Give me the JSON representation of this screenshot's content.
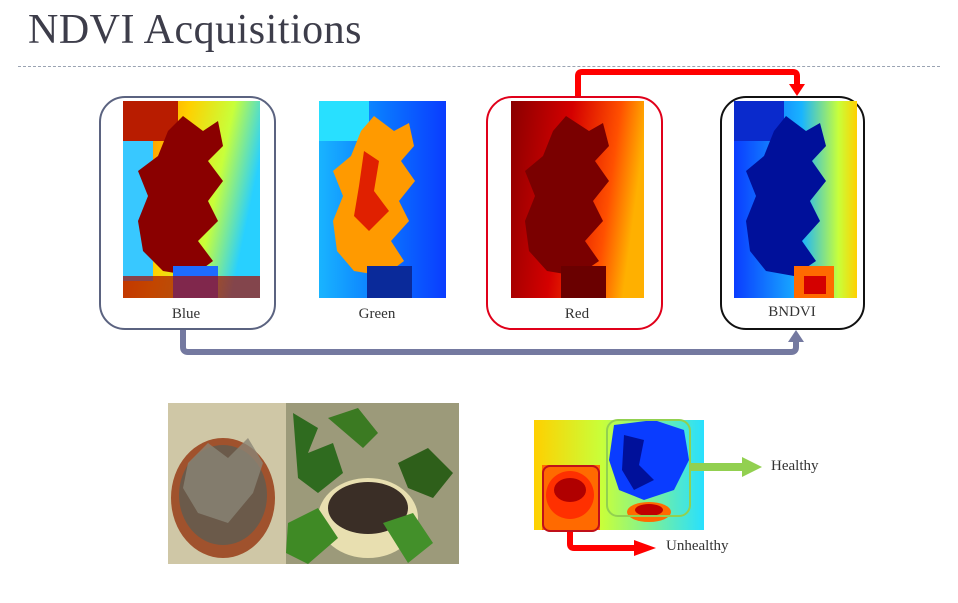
{
  "title": "NDVI Acquisitions",
  "bands": [
    {
      "label": "Blue"
    },
    {
      "label": "Green"
    },
    {
      "label": "Red"
    },
    {
      "label": "BNDVI"
    }
  ],
  "legend": {
    "healthy": "Healthy",
    "unhealthy": "Unhealthy"
  },
  "colors": {
    "blue_frame": "#5b6380",
    "red_frame": "#e0001a",
    "black_frame": "#111111",
    "arrow_red": "#ff0000",
    "arrow_gray": "#7479a0",
    "arrow_green": "#92d050"
  }
}
